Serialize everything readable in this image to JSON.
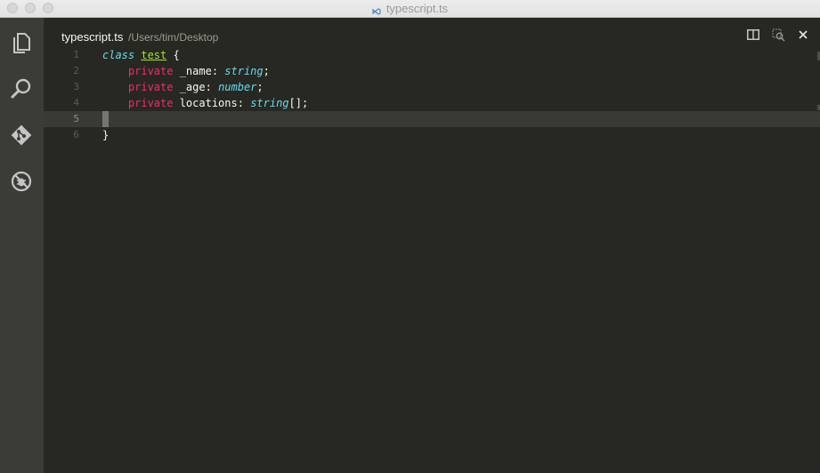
{
  "window": {
    "title": "typescript.ts"
  },
  "activity_bar": {
    "items": [
      {
        "name": "explorer",
        "icon": "files-icon"
      },
      {
        "name": "search",
        "icon": "search-icon"
      },
      {
        "name": "git",
        "icon": "git-icon"
      },
      {
        "name": "debug",
        "icon": "debug-icon"
      }
    ]
  },
  "editor": {
    "filename": "typescript.ts",
    "path": "/Users/tim/Desktop",
    "actions": [
      "split-editor-icon",
      "open-changes-icon",
      "close-icon"
    ],
    "line_numbers": [
      "1",
      "2",
      "3",
      "4",
      "5",
      "6"
    ],
    "current_line": 5,
    "code": {
      "line1": {
        "keyword": "class",
        "name": "test",
        "brace": " {"
      },
      "line2": {
        "indent": "    ",
        "modifier": "private",
        "ident": " _name: ",
        "type": "string",
        "end": ";"
      },
      "line3": {
        "indent": "    ",
        "modifier": "private",
        "ident": " _age: ",
        "type": "number",
        "end": ";"
      },
      "line4": {
        "indent": "    ",
        "modifier": "private",
        "ident": " locations: ",
        "type": "string",
        "end": "[];"
      },
      "line6": {
        "brace": "}"
      }
    }
  },
  "colors": {
    "background": "#272822",
    "keyword": "#66d9ef",
    "class_name": "#a6e22e",
    "modifier": "#f92672",
    "text": "#f8f8f2"
  }
}
